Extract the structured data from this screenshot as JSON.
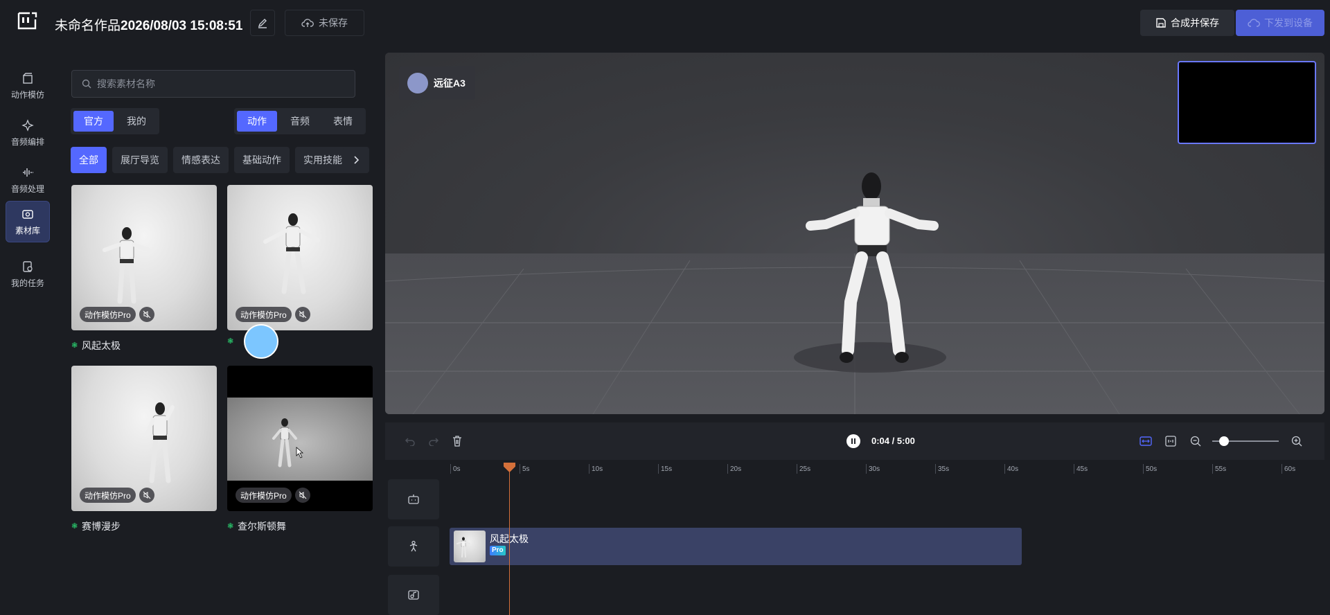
{
  "header": {
    "title_prefix": "未命名作品",
    "title_datetime": "2026/08/03 15:08:51",
    "unsaved_label": "未保存",
    "save_label": "合成并保存",
    "download_label": "下发到设备"
  },
  "leftnav": {
    "items": [
      {
        "label": "动作模仿",
        "icon": "motion-imitation-icon"
      },
      {
        "label": "音频编排",
        "icon": "audio-arrange-icon"
      },
      {
        "label": "音频处理",
        "icon": "audio-process-icon"
      },
      {
        "label": "素材库",
        "icon": "asset-library-icon",
        "active": true
      },
      {
        "label": "我的任务",
        "icon": "my-tasks-icon"
      }
    ]
  },
  "panel": {
    "search_placeholder": "搜索素材名称",
    "source_tabs": [
      "官方",
      "我的"
    ],
    "type_tabs": [
      "动作",
      "音频",
      "表情"
    ],
    "categories": [
      "全部",
      "展厅导览",
      "情感表达",
      "基础动作",
      "实用技能"
    ],
    "cards": [
      {
        "name": "风起太极",
        "badge": "动作模仿Pro"
      },
      {
        "name": "",
        "badge": "动作模仿Pro"
      },
      {
        "name": "赛博漫步",
        "badge": "动作模仿Pro"
      },
      {
        "name": "查尔斯顿舞",
        "badge": "动作模仿Pro"
      }
    ]
  },
  "preview": {
    "robot_name": "远征A3"
  },
  "controls": {
    "time": "0:04 / 5:00",
    "zoom_level": 0.1
  },
  "timeline": {
    "ticks": [
      "0s",
      "5s",
      "10s",
      "15s",
      "20s",
      "25s",
      "30s",
      "35s",
      "40s",
      "45s",
      "50s",
      "55s",
      "60s"
    ],
    "clip": {
      "name": "风起太极",
      "tag": "Pro"
    }
  },
  "colors": {
    "accent": "#5468ff",
    "playhead": "#d4703a",
    "clip_bg": "#3a4266",
    "dot_green": "#29c36a"
  }
}
